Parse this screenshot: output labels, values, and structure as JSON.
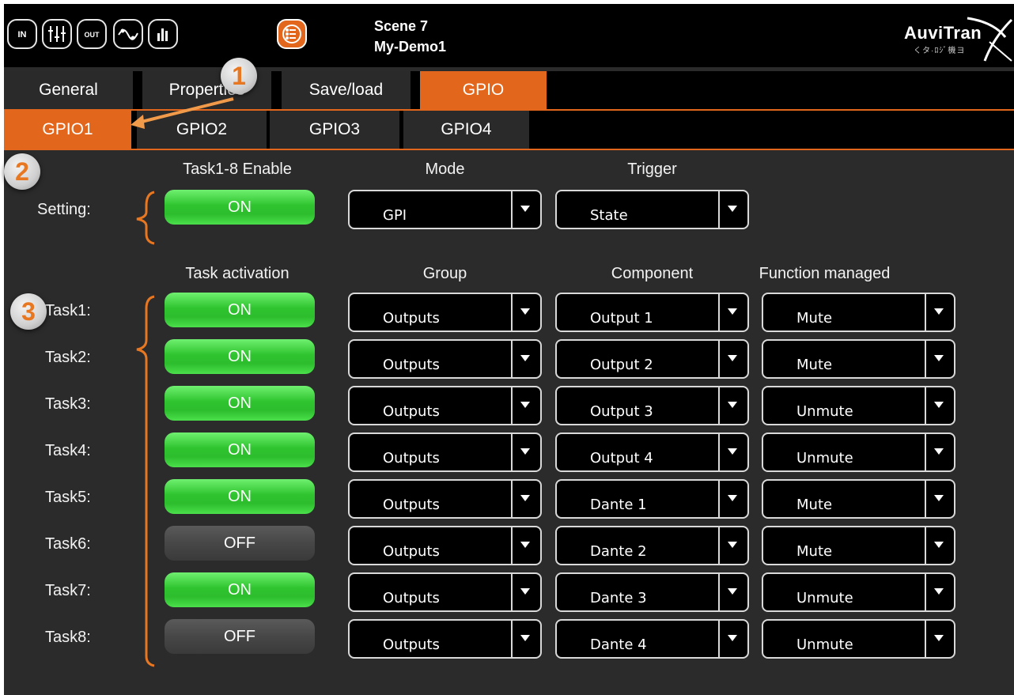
{
  "header": {
    "scene_label": "Scene 7",
    "project_name": "My-Demo1",
    "logo_text": "AuviTran",
    "logo_sub": "くタ·ﾛｼﾞ機ヨ",
    "icons": [
      {
        "name": "input-icon",
        "glyph": "IN"
      },
      {
        "name": "mixer-icon",
        "glyph": ""
      },
      {
        "name": "output-icon",
        "glyph": "OUT"
      },
      {
        "name": "eq-curve-icon",
        "glyph": ""
      },
      {
        "name": "meter-icon",
        "glyph": ""
      },
      {
        "name": "list-menu-icon",
        "glyph": "",
        "active": true
      }
    ],
    "accent_color": "#e2661c"
  },
  "main_tabs": [
    {
      "label": "General"
    },
    {
      "label": "Properties"
    },
    {
      "label": "Save/load"
    },
    {
      "label": "GPIO",
      "active": true
    }
  ],
  "gpio_tabs": [
    {
      "label": "GPIO1",
      "active": true
    },
    {
      "label": "GPIO2"
    },
    {
      "label": "GPIO3"
    },
    {
      "label": "GPIO4"
    }
  ],
  "settings": {
    "headers": {
      "enable": "Task1-8 Enable",
      "mode": "Mode",
      "trigger": "Trigger"
    },
    "row_label": "Setting:",
    "enable_value": "ON",
    "mode_value": "GPI",
    "trigger_value": "State"
  },
  "tasks": {
    "headers": {
      "activation": "Task activation",
      "group": "Group",
      "component": "Component",
      "function": "Function managed"
    },
    "rows": [
      {
        "label": "Task1:",
        "activation": "ON",
        "group": "Outputs",
        "component": "Output 1",
        "function": "Mute"
      },
      {
        "label": "Task2:",
        "activation": "ON",
        "group": "Outputs",
        "component": "Output 2",
        "function": "Mute"
      },
      {
        "label": "Task3:",
        "activation": "ON",
        "group": "Outputs",
        "component": "Output 3",
        "function": "Unmute"
      },
      {
        "label": "Task4:",
        "activation": "ON",
        "group": "Outputs",
        "component": "Output 4",
        "function": "Unmute"
      },
      {
        "label": "Task5:",
        "activation": "ON",
        "group": "Outputs",
        "component": "Dante 1",
        "function": "Mute"
      },
      {
        "label": "Task6:",
        "activation": "OFF",
        "group": "Outputs",
        "component": "Dante 2",
        "function": "Mute"
      },
      {
        "label": "Task7:",
        "activation": "ON",
        "group": "Outputs",
        "component": "Dante 3",
        "function": "Unmute"
      },
      {
        "label": "Task8:",
        "activation": "OFF",
        "group": "Outputs",
        "component": "Dante 4",
        "function": "Unmute"
      }
    ]
  },
  "annotations": [
    {
      "label": "1"
    },
    {
      "label": "2"
    },
    {
      "label": "3"
    }
  ],
  "colors": {
    "on": "#2fc42f",
    "off": "#474747",
    "accent": "#e2661c"
  }
}
